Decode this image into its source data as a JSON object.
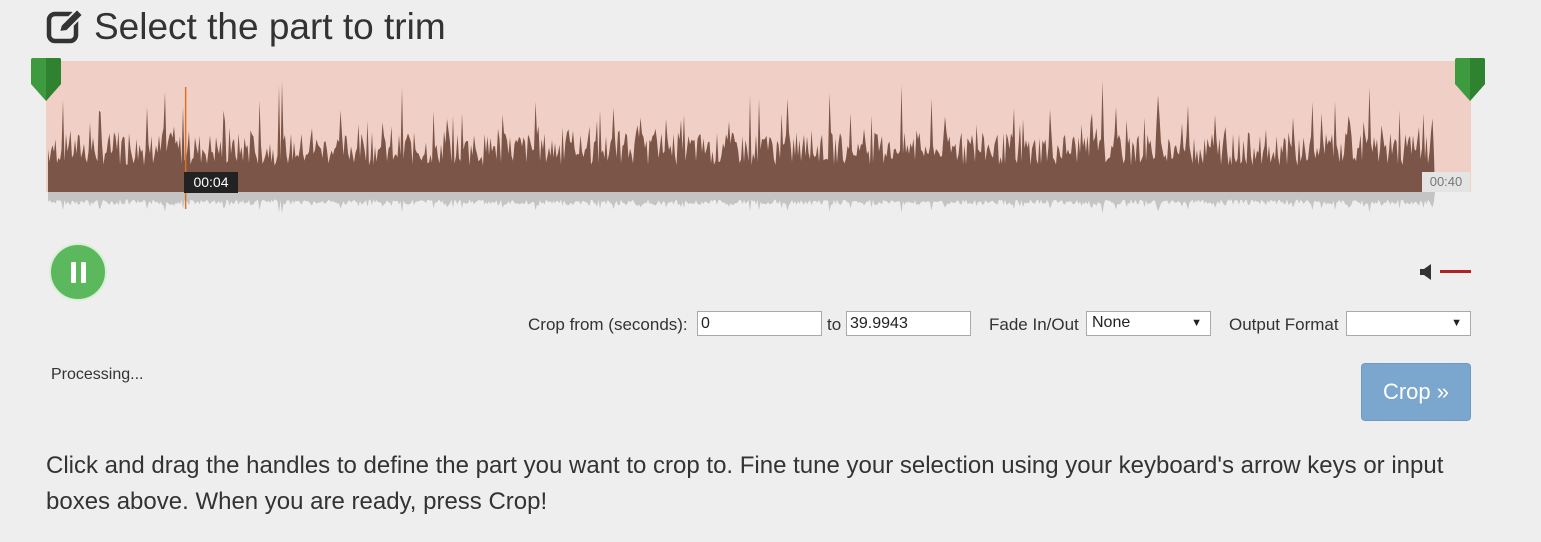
{
  "header": {
    "title": "Select the part to trim",
    "icon": "edit-icon"
  },
  "waveform": {
    "current_time_label": "00:04",
    "end_time_label": "00:40",
    "playhead_fraction": 0.098,
    "colors": {
      "selection_bg": "#f0d0c6",
      "wave": "#7b5548",
      "reflection": "#c4c4c4",
      "handle": "#3e9a3e",
      "playhead": "#e07020"
    }
  },
  "player": {
    "button_icon": "pause-icon",
    "volume_icon": "speaker-icon",
    "volume_color": "#b22222"
  },
  "controls": {
    "crop_from_label": "Crop from (seconds):",
    "crop_from_value": "0",
    "to_label": "to",
    "crop_to_value": "39.9943",
    "fade_label": "Fade In/Out",
    "fade_value": "None",
    "format_label": "Output Format",
    "format_value": ""
  },
  "status": {
    "text": "Processing..."
  },
  "crop_button": {
    "label": "Crop »",
    "color": "#7ba7cf"
  },
  "help": {
    "text": "Click and drag the handles to define the part you want to crop to. Fine tune your selection using your keyboard's arrow keys or input boxes above. When you are ready, press Crop!"
  }
}
